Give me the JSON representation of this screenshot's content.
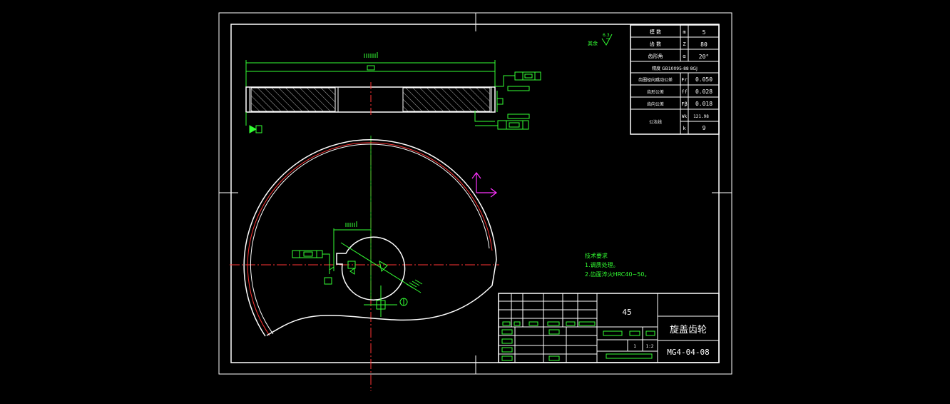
{
  "params_table": {
    "rows": [
      {
        "label": "模 数",
        "sym": "m",
        "value": "5"
      },
      {
        "label": "齿 数",
        "sym": "Z",
        "value": "80"
      },
      {
        "label": "齿形角",
        "sym": "α",
        "value": "20°"
      }
    ],
    "precision": "精度  GB10095-88    8GJ",
    "tol_rows": [
      {
        "label": "齿圈径向跳动公差",
        "sym": "Fr",
        "value": "0.050"
      },
      {
        "label": "齿形公差",
        "sym": "ff",
        "value": "0.028"
      },
      {
        "label": "齿向公差",
        "sym": "Fβ",
        "value": "0.018"
      }
    ],
    "span": {
      "label": "公法线",
      "sym1": "Wk",
      "value1": "121.98",
      "sym2": "k",
      "value2": "9"
    }
  },
  "roughness_note": {
    "rest": "其余",
    "value": "6.3"
  },
  "tech_requirements": {
    "title": "技术要求",
    "items": [
      "1.调质处理。",
      "2.齿面淬火HRC40~50。"
    ]
  },
  "title_block": {
    "material": "45",
    "part_name": "旋盖齿轮",
    "drawing_no": "MG4-04-08",
    "quantity": "1",
    "scale": "1:2"
  },
  "colors": {
    "outline": "#ffffff",
    "dimension": "#33ff33",
    "centerline": "#ff3333",
    "ucs": "#ff33ff"
  }
}
